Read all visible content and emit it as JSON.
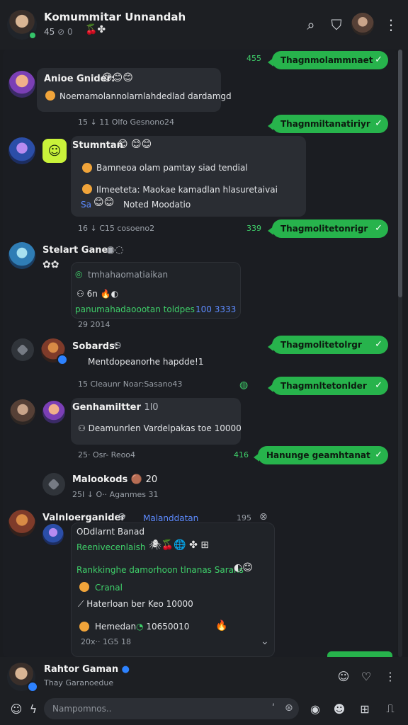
{
  "header": {
    "title": "Komummitar Unnandah",
    "subtitle": "45",
    "subtitle_icons": "⊘ 0",
    "emoji": "🍒✤",
    "icons": {
      "search": "search-icon",
      "shield": "shield-icon",
      "more": "more-vertical-icon"
    }
  },
  "messages": {
    "sent1": {
      "text": "Thagnmolammnaet",
      "time": "455"
    },
    "m1": {
      "name": "Anioe Gnider:",
      "emoji": "😊😊😊",
      "text": "Noemamolannolarnlahdedlad dardamgd",
      "meta": "15  ↓ 11 Olfo Gesnono24"
    },
    "sent2": {
      "text": "Thagnmiltanatiriyr"
    },
    "m2": {
      "name": "Stumntan",
      "emoji": "😊 😊😊",
      "line1": "Bamneoa olam pamtay siad tendial",
      "line2": "Ilmeeteta: Maokae kamadlan hlasuretaivai",
      "line3": "Noted Moodatio",
      "meta": "16  ↓ C15 cosoeno2",
      "meta_right": "339"
    },
    "sent3": {
      "text": "Thagmolitetonrigr"
    },
    "m3": {
      "name": "Stelart Ganes",
      "line1": "tmhahaomatiaikan",
      "line2": "6n",
      "line3": "panumahadaoootan toldpes",
      "line3b": "100 3333",
      "meta": "29   2014"
    },
    "sent4": {
      "text": "Thagmolitetolrgr"
    },
    "m4": {
      "name": "Sobards:",
      "text": "Mentdopeanorhe hapdde!1",
      "meta": "15   Cleaunr Noar:Sasano43"
    },
    "sent5": {
      "text": "Thagmnltetonlder"
    },
    "m5": {
      "name": "Genhamiltter",
      "suffix": "1l0",
      "text": "Deamunrlen Vardelpakas toe 10000",
      "meta": "25·  Osr-  Reoo4"
    },
    "sent6": {
      "text": "Hanunge geamhtanat",
      "time": "416"
    },
    "m6": {
      "name": "Malookods",
      "suffix": "20",
      "meta": "25I  ↓ O··  Aganmes   31"
    },
    "m7": {
      "name": "Valnloerganider",
      "tag": "Malanddatan",
      "tag_num": "195",
      "subtitle": "ODdlarnt Banad",
      "line1": "Reenivecenlaish",
      "line2": "Rankkinghe damorhoon tlnanas Sarans",
      "line3": "Cranal",
      "line4": "Haterloan ber Keo 10000",
      "line5": "Hemedan",
      "line5b": "10650010",
      "meta": "20x··  1G5 18"
    }
  },
  "footer": {
    "name": "Rahtor Gaman",
    "status": "Thay Garanoedue",
    "placeholder": "Nampomnos.."
  }
}
